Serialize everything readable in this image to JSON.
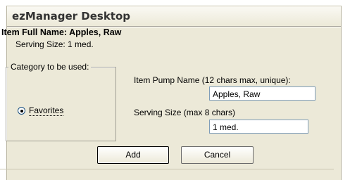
{
  "window": {
    "title": "ezManager Desktop"
  },
  "item": {
    "full_name_line": "Item Full Name: Apples, Raw",
    "serving_line": "Serving Size: 1 med."
  },
  "category": {
    "group_label": "Category to be used:",
    "option_label": "Favorites",
    "option_selected": true
  },
  "pump_name": {
    "label": "Item Pump Name (12 chars max, unique):",
    "value": "Apples, Raw"
  },
  "serving_size": {
    "label": "Serving Size (max 8 chars)",
    "value": "1 med."
  },
  "buttons": {
    "add_label": "Add",
    "cancel_label": "Cancel"
  }
}
